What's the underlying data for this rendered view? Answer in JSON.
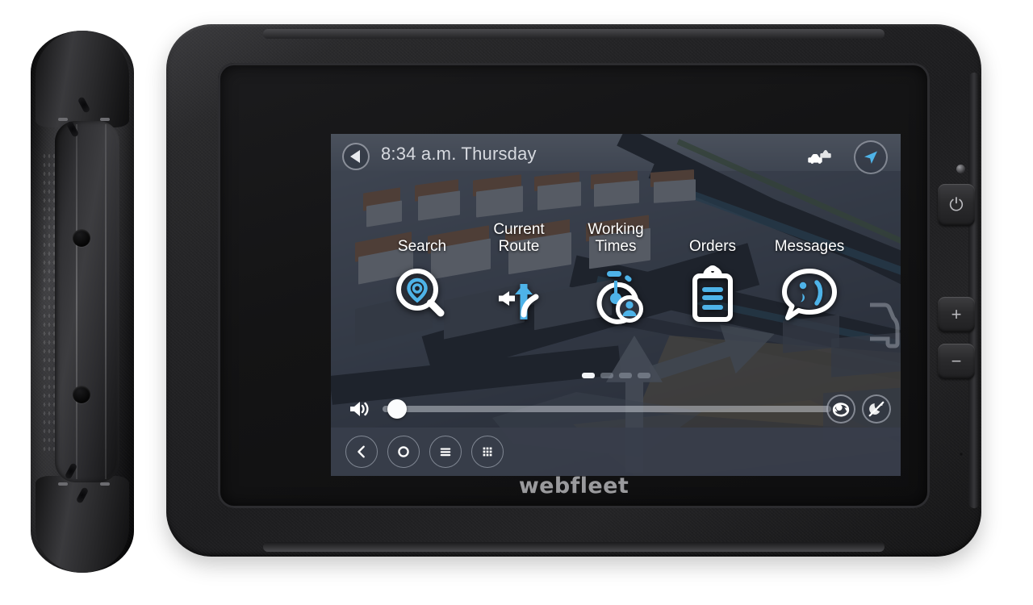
{
  "device": {
    "brand": "webfleet",
    "hardware_buttons": [
      {
        "name": "power",
        "glyph": "⏻"
      },
      {
        "name": "volume-up",
        "glyph": "+"
      },
      {
        "name": "volume-down",
        "glyph": "−"
      }
    ]
  },
  "screen": {
    "topbar": {
      "back_icon": "back-arrow-icon",
      "clock": "8:34 a.m. Thursday",
      "traffic_icon": "traffic-cars-icon",
      "nav_arrow_icon": "navigation-arrow-icon"
    },
    "main_menu": {
      "items": [
        {
          "label": "Search",
          "icon": "search-pin-icon"
        },
        {
          "label": "Current\nRoute",
          "label_line1": "Current",
          "label_line2": "Route",
          "icon": "current-route-arrows-icon"
        },
        {
          "label": "Working\nTimes",
          "label_line1": "Working",
          "label_line2": "Times",
          "icon": "working-times-stopwatch-icon"
        },
        {
          "label": "Orders",
          "icon": "orders-clipboard-icon"
        },
        {
          "label": "Messages",
          "icon": "messages-bubble-icon"
        }
      ],
      "page_count": 4,
      "active_page": 1,
      "edge_partial_icon": "vehicle-icon"
    },
    "volume_bar": {
      "speaker_icon": "speaker-volume-icon",
      "value_percent": 3,
      "shortcut_icons": [
        {
          "name": "route-view-toggle-icon"
        },
        {
          "name": "night-mode-off-icon"
        }
      ]
    },
    "system_bar": {
      "buttons": [
        {
          "name": "android-back-button",
          "icon": "chevron-left-icon"
        },
        {
          "name": "android-home-button",
          "icon": "circle-icon"
        },
        {
          "name": "android-recents-button",
          "icon": "hamburger-icon"
        },
        {
          "name": "android-app-drawer-button",
          "icon": "grid-dots-icon"
        }
      ]
    }
  },
  "colors": {
    "accent_blue": "#4eb3e8",
    "icon_white": "#ffffff",
    "screen_bg": "#2b2f38",
    "system_bar": "#383e4a",
    "case_black": "#212123"
  }
}
